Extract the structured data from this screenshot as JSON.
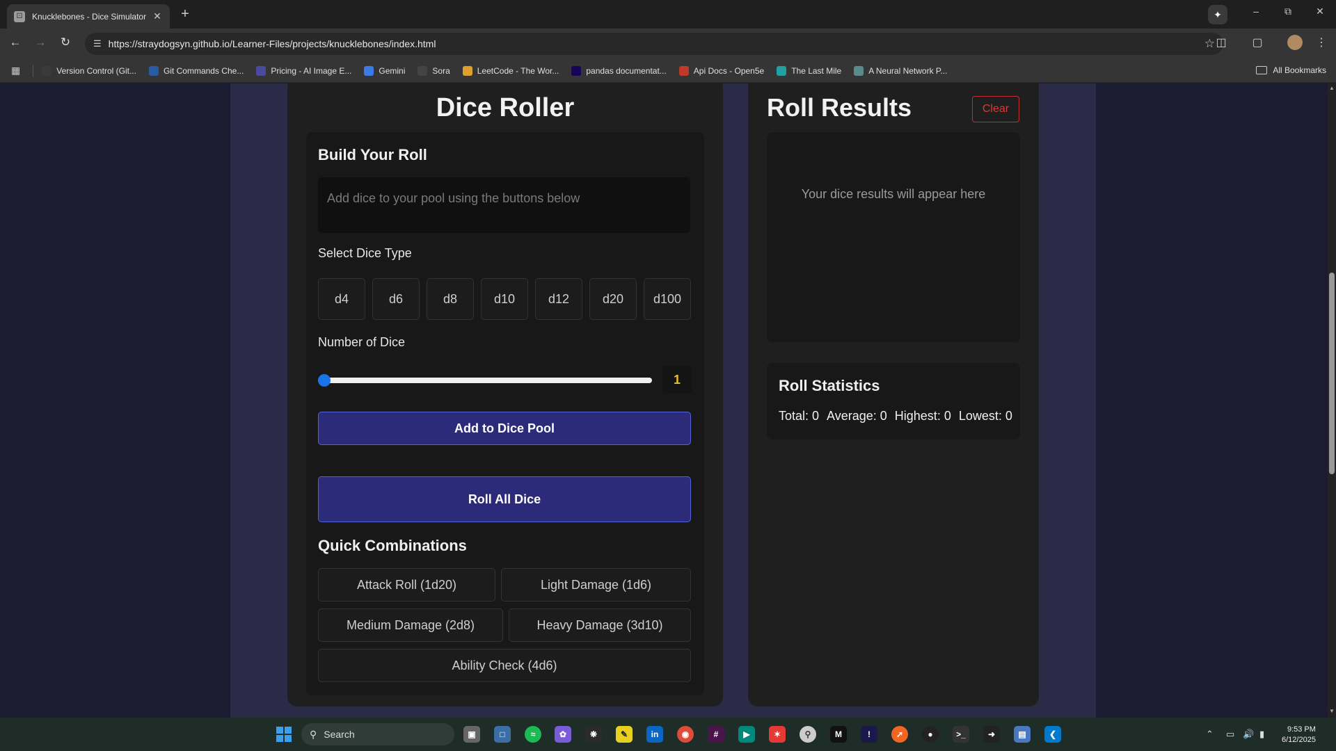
{
  "browser": {
    "tab_title": "Knucklebones - Dice Simulator",
    "url": "https://straydogsyn.github.io/Learner-Files/projects/knucklebones/index.html",
    "bookmarks": [
      {
        "label": "Version Control (Git...",
        "icon": "terminal-icon",
        "color": "#3a3a3a"
      },
      {
        "label": "Git Commands Che...",
        "icon": "git-icon",
        "color": "#2a5aa0"
      },
      {
        "label": "Pricing - AI Image E...",
        "icon": "image-icon",
        "color": "#4a4aa0"
      },
      {
        "label": "Gemini",
        "icon": "gemini-icon",
        "color": "#3b7be8"
      },
      {
        "label": "Sora",
        "icon": "sora-icon",
        "color": "#444444"
      },
      {
        "label": "LeetCode - The Wor...",
        "icon": "leetcode-icon",
        "color": "#e0a030"
      },
      {
        "label": "pandas documentat...",
        "icon": "pandas-icon",
        "color": "#150458"
      },
      {
        "label": "Api Docs - Open5e",
        "icon": "open5e-icon",
        "color": "#c0392b"
      },
      {
        "label": "The Last Mile",
        "icon": "lastmile-icon",
        "color": "#20a0a0"
      },
      {
        "label": "A Neural Network P...",
        "icon": "neural-icon",
        "color": "#5a8a8a"
      }
    ],
    "all_bookmarks": "All Bookmarks"
  },
  "roller": {
    "title": "Dice Roller",
    "build_heading": "Build Your Roll",
    "pool_placeholder": "Add dice to your pool using the buttons below",
    "select_label": "Select Dice Type",
    "dice_types": [
      "d4",
      "d6",
      "d8",
      "d10",
      "d12",
      "d20",
      "d100"
    ],
    "number_label": "Number of Dice",
    "number_value": "1",
    "slider_level": 0,
    "add_button": "Add to Dice Pool",
    "roll_button": "Roll All Dice",
    "quick_heading": "Quick Combinations",
    "combos": [
      "Attack Roll (1d20)",
      "Light Damage (1d6)",
      "Medium Damage (2d8)",
      "Heavy Damage (3d10)",
      "Ability Check (4d6)"
    ]
  },
  "results": {
    "title": "Roll Results",
    "clear_button": "Clear",
    "placeholder": "Your dice results will appear here",
    "stats_heading": "Roll Statistics",
    "stats": {
      "total": "Total: 0",
      "average": "Average: 0",
      "highest": "Highest: 0",
      "lowest": "Lowest: 0"
    }
  },
  "taskbar": {
    "search_label": "Search",
    "time": "9:53 PM",
    "date": "6/12/2025"
  },
  "colors": {
    "accent": "#2b2b7a",
    "accent_border": "#5462d8",
    "count_yellow": "#e8c21e",
    "clear_red": "#d83a3a"
  }
}
